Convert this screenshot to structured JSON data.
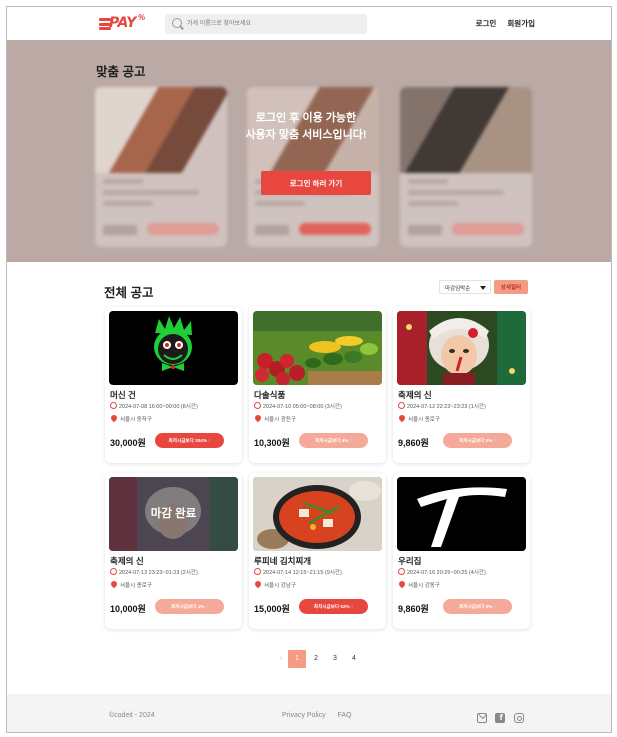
{
  "header": {
    "logo_text": "PAY",
    "logo_sup": "%",
    "search_placeholder": "가게 이름으로 찾아보세요",
    "login": "로그인",
    "signup": "회원가입"
  },
  "custom_ads": {
    "title": "맞춤 공고",
    "message_line1": "로그인 후 이용 가능한",
    "message_line2": "사용자 맞춤 서비스입니다!",
    "cta": "로그인 하러 가기"
  },
  "all_ads": {
    "title": "전체 공고",
    "sort_selected": "마감임박순",
    "filter_button": "상세필터",
    "cards": [
      {
        "name": "머신 건",
        "time": "2024-07-08 16:00~00:00 (8시간)",
        "location": "서울시 동작구",
        "price": "30,000원",
        "badge": "최저시급보다 304% ↑",
        "hot": true,
        "closed": false
      },
      {
        "name": "다솔식품",
        "time": "2024-07-10 05:00~08:00 (3시간)",
        "location": "서울시 광진구",
        "price": "10,300원",
        "badge": "최저시급보다 4% ↑",
        "hot": false,
        "closed": false
      },
      {
        "name": "축제의 신",
        "time": "2024-07-12 22:23~23:23 (1시간)",
        "location": "서울시 종로구",
        "price": "9,860원",
        "badge": "최저시급보다 0% ↑",
        "hot": false,
        "closed": false
      },
      {
        "name": "축제의 신",
        "time": "2024-07-13 23:23~01:23 (2시간)",
        "location": "서울시 종로구",
        "price": "10,000원",
        "badge": "최저시급보다 1% ↑",
        "hot": false,
        "closed": true,
        "closed_label": "마감 완료"
      },
      {
        "name": "루피네 김치찌개",
        "time": "2024-07-14 12:15~21:15 (9시간)",
        "location": "서울시 강남구",
        "price": "15,000원",
        "badge": "최저시급보다 52% ↑",
        "hot": true,
        "closed": false
      },
      {
        "name": "우리집",
        "time": "2024-07-16 20:25~00:25 (4시간)",
        "location": "서울시 강동구",
        "price": "9,860원",
        "badge": "최저시급보다 0% ↑",
        "hot": false,
        "closed": false
      }
    ]
  },
  "pagination": {
    "prev": "‹",
    "pages": [
      "1",
      "2",
      "3",
      "4"
    ],
    "current": "1"
  },
  "footer": {
    "copyright": "©codeit - 2024",
    "privacy": "Privacy Policy",
    "faq": "FAQ",
    "icons": [
      "mail-icon",
      "facebook-icon",
      "instagram-icon"
    ]
  },
  "colors": {
    "accent": "#e8473f",
    "accent_soft": "#f5a999",
    "band": "#bba9a5"
  }
}
